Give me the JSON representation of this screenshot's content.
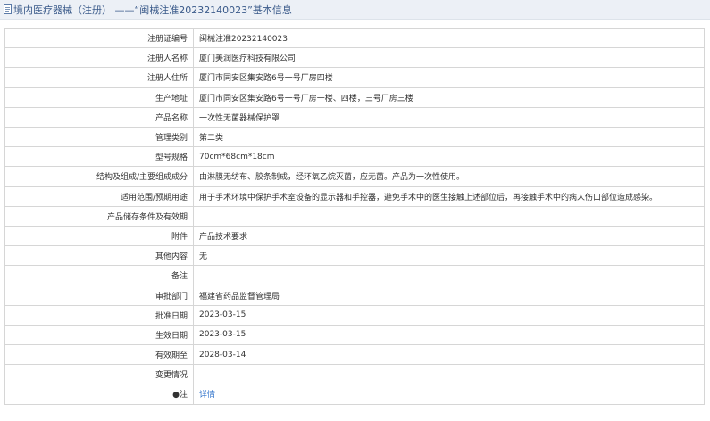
{
  "header": {
    "title": "境内医疗器械（注册） ——“闽械注准20232140023”基本信息"
  },
  "rows": [
    {
      "label": "注册证编号",
      "value": "闽械注准20232140023"
    },
    {
      "label": "注册人名称",
      "value": "厦门美润医疗科技有限公司"
    },
    {
      "label": "注册人住所",
      "value": "厦门市同安区集安路6号一号厂房四楼"
    },
    {
      "label": "生产地址",
      "value": "厦门市同安区集安路6号一号厂房一楼、四楼，三号厂房三楼"
    },
    {
      "label": "产品名称",
      "value": "一次性无菌器械保护罩"
    },
    {
      "label": "管理类别",
      "value": "第二类"
    },
    {
      "label": "型号规格",
      "value": "70cm*68cm*18cm"
    },
    {
      "label": "结构及组成/主要组成成分",
      "value": "由淋膜无纺布、胶条制成，经环氧乙烷灭菌，应无菌。产品为一次性使用。"
    },
    {
      "label": "适用范围/预期用途",
      "value": "用于手术环境中保护手术室设备的显示器和手控器，避免手术中的医生接触上述部位后，再接触手术中的病人伤口部位造成感染。"
    },
    {
      "label": "产品储存条件及有效期",
      "value": ""
    },
    {
      "label": "附件",
      "value": "产品技术要求"
    },
    {
      "label": "其他内容",
      "value": "无"
    },
    {
      "label": "备注",
      "value": ""
    },
    {
      "label": "审批部门",
      "value": "福建省药品监督管理局"
    },
    {
      "label": "批准日期",
      "value": "2023-03-15"
    },
    {
      "label": "生效日期",
      "value": "2023-03-15"
    },
    {
      "label": "有效期至",
      "value": "2028-03-14"
    },
    {
      "label": "变更情况",
      "value": ""
    }
  ],
  "note_row": {
    "label": "●注",
    "link": "详情"
  },
  "colors": {
    "header_bg": "#ecf0f6",
    "title": "#3a5a8a",
    "border": "#d6d6d6",
    "link": "#2a6fc9"
  }
}
